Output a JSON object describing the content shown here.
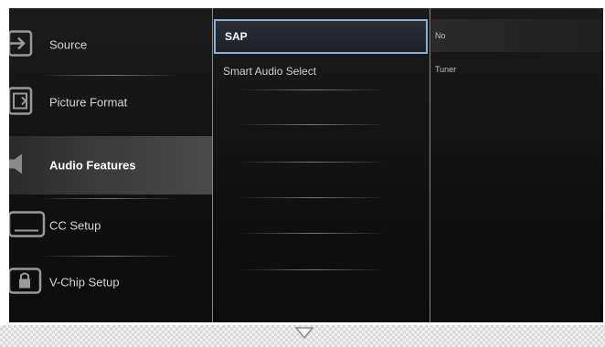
{
  "sidebar": {
    "items": [
      {
        "label": "Source",
        "icon": "input-source-icon",
        "active": false
      },
      {
        "label": "Picture Format",
        "icon": "picture-format-icon",
        "active": false
      },
      {
        "label": "Audio Features",
        "icon": "speaker-icon",
        "active": true
      },
      {
        "label": "CC Setup",
        "icon": "closed-caption-icon",
        "active": false
      },
      {
        "label": "V-Chip Setup",
        "icon": "lock-icon",
        "active": false
      }
    ]
  },
  "options": {
    "items": [
      {
        "label": "SAP",
        "selected": true
      },
      {
        "label": "Smart Audio Select",
        "selected": false
      }
    ]
  },
  "values": {
    "items": [
      {
        "label": "No"
      },
      {
        "label": "Tuner"
      }
    ]
  },
  "colors": {
    "selection_border": "#8fb1d6",
    "background": "#111111"
  }
}
